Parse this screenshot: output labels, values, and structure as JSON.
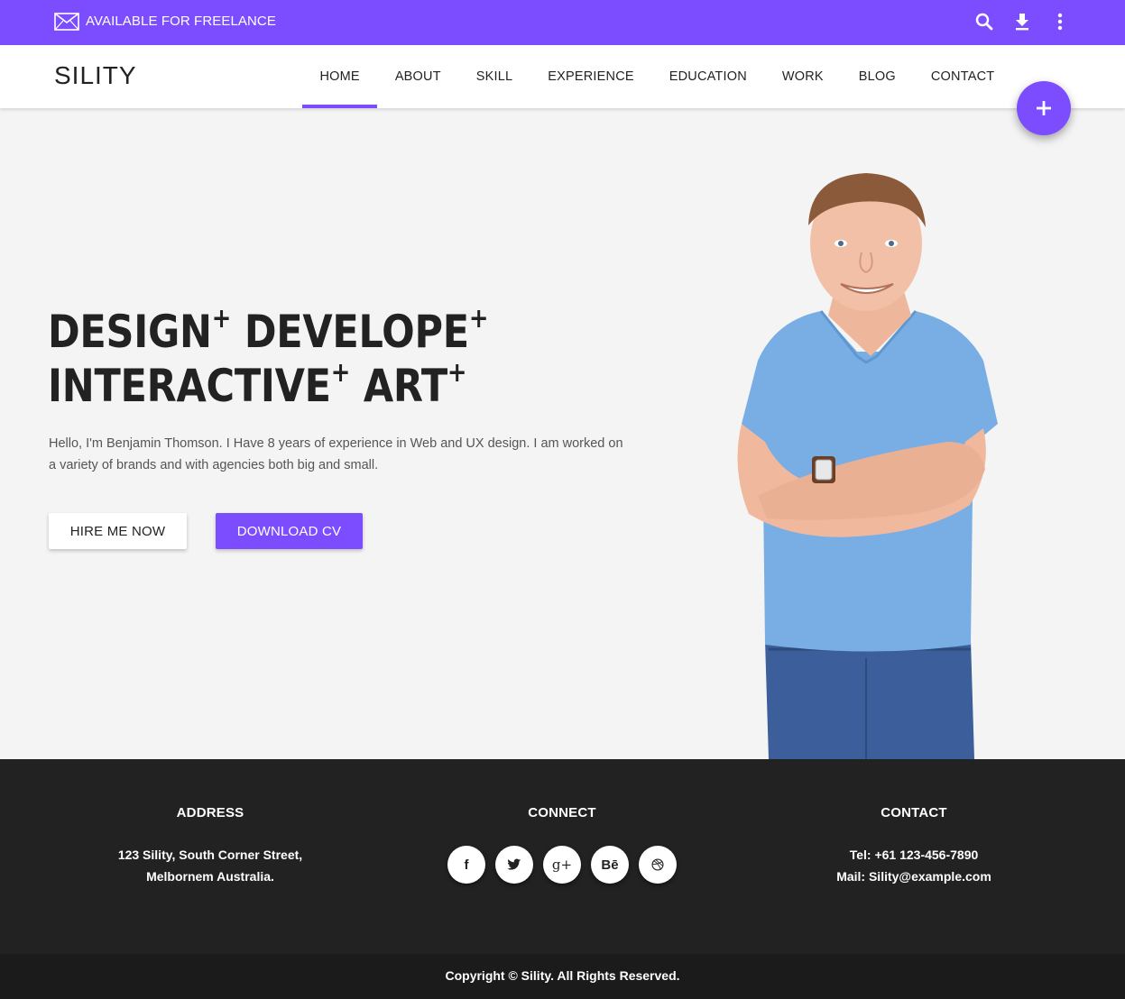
{
  "topbar": {
    "freelance_label": "AVAILABLE FOR FREELANCE",
    "icons": [
      "mail-icon",
      "search-icon",
      "download-icon",
      "more-vert-icon"
    ]
  },
  "nav": {
    "brand": "SILITY",
    "items": [
      "HOME",
      "ABOUT",
      "SKILL",
      "EXPERIENCE",
      "EDUCATION",
      "WORK",
      "BLOG",
      "CONTACT"
    ],
    "active": "HOME",
    "fab_label": "+"
  },
  "hero": {
    "line1": {
      "word1": "DESIGN",
      "word2": "DEVELOPE"
    },
    "line2": {
      "word1": "INTERACTIVE",
      "word2": "ART"
    },
    "plus": "+",
    "intro": "Hello, I'm Benjamin Thomson. I Have 8 years of experience in Web and UX design. I am worked on a variety of brands and with agencies both big and small.",
    "hire_button": "HIRE ME NOW",
    "cv_button": "DOWNLOAD CV"
  },
  "footer": {
    "address": {
      "title": "ADDRESS",
      "line1": "123 Sility, South Corner Street,",
      "line2": "Melbornem Australia."
    },
    "connect": {
      "title": "CONNECT",
      "socials": [
        {
          "name": "facebook-icon",
          "glyph": "f"
        },
        {
          "name": "twitter-icon",
          "glyph": ""
        },
        {
          "name": "google-plus-icon",
          "glyph": "g+"
        },
        {
          "name": "behance-icon",
          "glyph": "Bē"
        },
        {
          "name": "dribbble-icon",
          "glyph": ""
        }
      ]
    },
    "contact": {
      "title": "CONTACT",
      "tel": "Tel: +61 123-456-7890",
      "mail": "Mail: Sility@example.com"
    },
    "copyright": "Copyright © Sility. All Rights Reserved."
  },
  "colors": {
    "accent": "#7c4dff",
    "footer_bg": "#222222",
    "copyright_bg": "#1b1b1b",
    "hero_bg": "#f4f4f5"
  }
}
